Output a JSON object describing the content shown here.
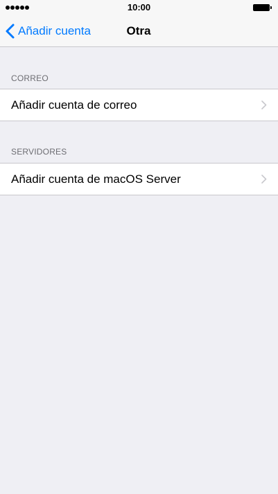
{
  "status_bar": {
    "time": "10:00",
    "signal_icon": "signal-dots-icon",
    "battery_icon": "battery-icon"
  },
  "nav": {
    "back_label": "Añadir cuenta",
    "back_icon": "chevron-left-icon",
    "title": "Otra"
  },
  "sections": [
    {
      "header": "CORREO",
      "items": [
        {
          "label": "Añadir cuenta de correo",
          "icon": "chevron-right-icon"
        }
      ]
    },
    {
      "header": "SERVIDORES",
      "items": [
        {
          "label": "Añadir cuenta de macOS Server",
          "icon": "chevron-right-icon"
        }
      ]
    }
  ],
  "colors": {
    "accent": "#007aff",
    "background": "#efeff4",
    "separator": "#c8c7cc",
    "section_header": "#6d6d72",
    "chevron": "#c7c7cc"
  }
}
